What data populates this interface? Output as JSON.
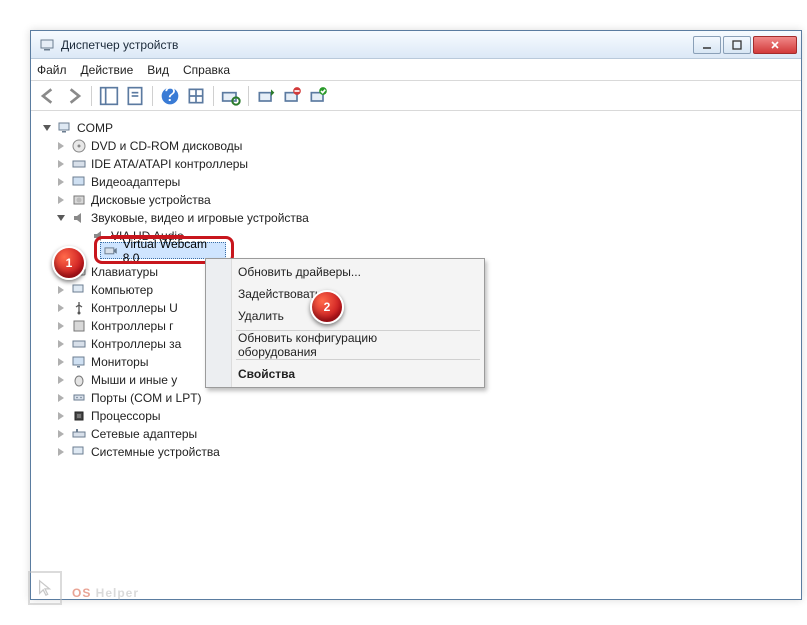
{
  "window": {
    "title": "Диспетчер устройств"
  },
  "menu": {
    "file": "Файл",
    "action": "Действие",
    "view": "Вид",
    "help": "Справка"
  },
  "tree": {
    "root": "COMP",
    "items": [
      "DVD и CD-ROM дисководы",
      "IDE ATA/ATAPI контроллеры",
      "Видеоадаптеры",
      "Дисковые устройства",
      "Звуковые, видео и игровые устройства",
      "VIA HD Audio",
      "Virtual Webcam 8.0",
      "Клавиатуры",
      "Компьютер",
      "Контроллеры USB",
      "Контроллеры гибких дисков",
      "Контроллеры запоминающих устройств",
      "Мониторы",
      "Мыши и иные указывающие устройства",
      "Порты (COM и LPT)",
      "Процессоры",
      "Сетевые адаптеры",
      "Системные устройства"
    ],
    "truncated": {
      "usb": "Контроллеры U",
      "floppy": "Контроллеры г",
      "storage": "Контроллеры за",
      "mice": "Мыши и иные у"
    }
  },
  "context_menu": {
    "update": "Обновить драйверы...",
    "enable": "Задействовать",
    "delete": "Удалить",
    "scan": "Обновить конфигурацию оборудования",
    "properties": "Свойства"
  },
  "callouts": {
    "one": "1",
    "two": "2"
  },
  "watermark": {
    "os": "OS",
    "helper": " Helper"
  }
}
